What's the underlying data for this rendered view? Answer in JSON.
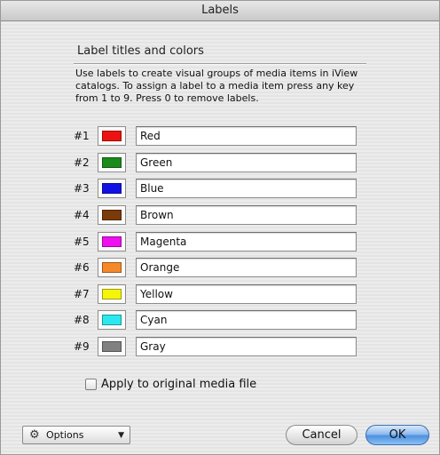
{
  "window": {
    "title": "Labels"
  },
  "section": {
    "title": "Label titles and colors",
    "description": "Use labels to create visual groups of media items in iView catalogs. To assign a label to a media item press any key from 1 to 9. Press 0 to remove labels."
  },
  "labels": [
    {
      "number": "#1",
      "name": "Red",
      "color": "#ee1111"
    },
    {
      "number": "#2",
      "name": "Green",
      "color": "#1a8a1a"
    },
    {
      "number": "#3",
      "name": "Blue",
      "color": "#1111e6"
    },
    {
      "number": "#4",
      "name": "Brown",
      "color": "#7a3a0a"
    },
    {
      "number": "#5",
      "name": "Magenta",
      "color": "#ee10ee"
    },
    {
      "number": "#6",
      "name": "Orange",
      "color": "#f5892a"
    },
    {
      "number": "#7",
      "name": "Yellow",
      "color": "#f5f50a"
    },
    {
      "number": "#8",
      "name": "Cyan",
      "color": "#2ae8ee"
    },
    {
      "number": "#9",
      "name": "Gray",
      "color": "#808080"
    }
  ],
  "apply_checkbox": {
    "label": "Apply to original media file",
    "checked": false
  },
  "footer": {
    "options_label": "Options",
    "cancel_label": "Cancel",
    "ok_label": "OK"
  },
  "icons": {
    "options": "gear-icon",
    "options_arrow": "chevron-down-icon"
  }
}
